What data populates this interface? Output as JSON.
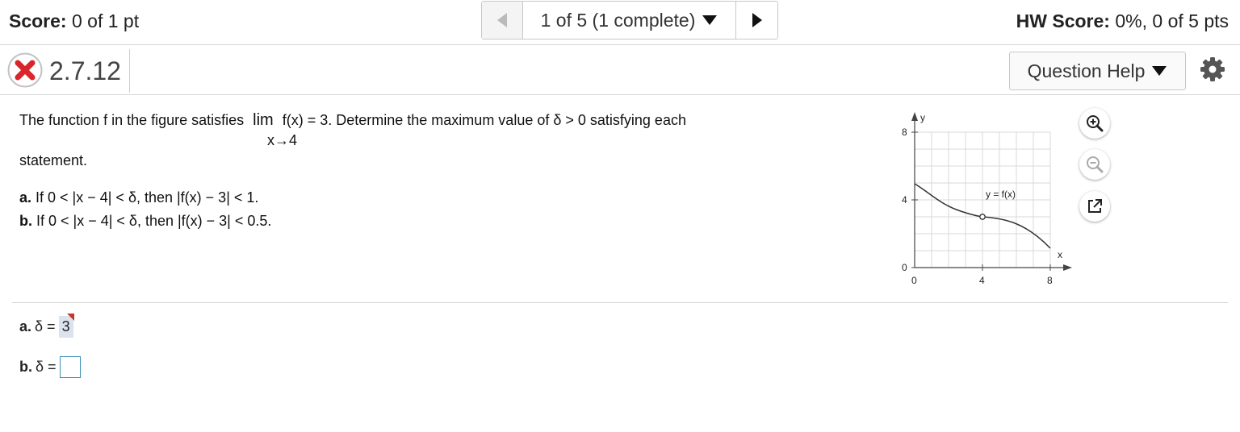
{
  "topbar": {
    "score_label": "Score:",
    "score_value": "0 of 1 pt",
    "nav_label": "1 of 5 (1 complete)",
    "hw_label": "HW Score:",
    "hw_value": "0%, 0 of 5 pts"
  },
  "question": {
    "number": "2.7.12",
    "status": "incorrect",
    "help_label": "Question Help"
  },
  "prompt": {
    "line1_pre": "The function f in the figure satisfies",
    "lim": "lim",
    "line1_post": "f(x) = 3. Determine the maximum value of δ > 0 satisfying each",
    "lim_sub": "x→4",
    "line2": "statement.",
    "part_a_label": "a.",
    "part_a_text": "If 0 < |x − 4| < δ, then |f(x) − 3| < 1.",
    "part_b_label": "b.",
    "part_b_text": "If 0 < |x − 4| < δ, then |f(x) − 3| < 0.5."
  },
  "graph": {
    "y_axis_label": "y",
    "x_axis_label": "x",
    "curve_label": "y = f(x)",
    "x_ticks": [
      "0",
      "4",
      "8"
    ],
    "y_ticks": [
      "0",
      "4",
      "8"
    ],
    "hole": [
      4,
      3
    ]
  },
  "answers": {
    "a_label": "a.",
    "a_prefix": "δ =",
    "a_value": "3",
    "b_label": "b.",
    "b_prefix": "δ =",
    "b_value": ""
  },
  "colors": {
    "incorrect": "#d9262b",
    "answer_bg": "#dbe3ef",
    "input_border": "#3a8fb7"
  },
  "icons": [
    "triangle-left-icon",
    "chevron-down-icon",
    "triangle-right-icon",
    "x-circle-icon",
    "gear-icon",
    "zoom-in-icon",
    "zoom-out-icon",
    "popout-icon"
  ]
}
